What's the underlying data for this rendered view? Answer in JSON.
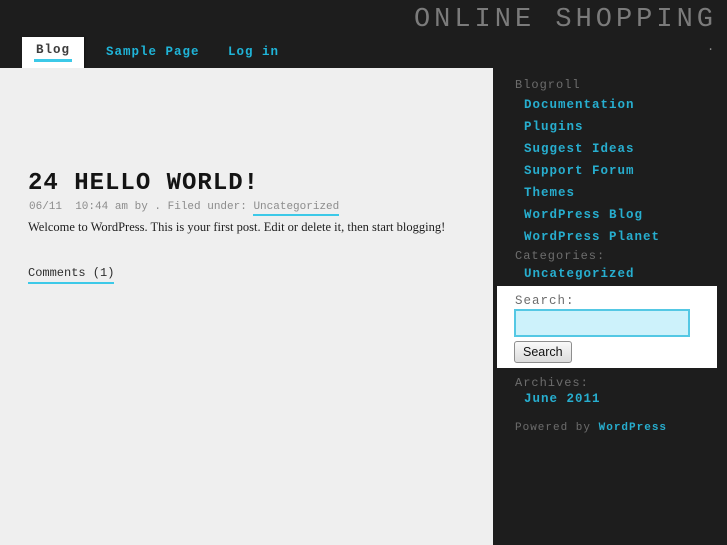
{
  "header": {
    "site_title": "ONLINE SHOPPING",
    "dot": ".",
    "nav": [
      {
        "label": "Blog",
        "active": true
      },
      {
        "label": "Sample Page",
        "active": false
      },
      {
        "label": "Log in",
        "active": false
      }
    ]
  },
  "post": {
    "title": "24 HELLO WORLD!",
    "meta_prefix": "06/11  10:44 am by . Filed under: ",
    "meta_category": "Uncategorized",
    "body": "Welcome to WordPress. This is your first post. Edit or delete it, then start blogging!",
    "comments_label": "Comments (1)"
  },
  "sidebar": {
    "blogroll_heading": "Blogroll",
    "blogroll_links": [
      "Documentation",
      "Plugins",
      "Suggest Ideas",
      "Support Forum",
      "Themes",
      "WordPress Blog",
      "WordPress Planet"
    ],
    "categories_heading": "Categories:",
    "categories_links": [
      "Uncategorized"
    ],
    "search": {
      "label": "Search:",
      "input_value": "",
      "button_label": "Search"
    },
    "archives_heading": "Archives:",
    "archives_links": [
      "June 2011"
    ],
    "powered_by_prefix": "Powered by ",
    "powered_by_link": "WordPress"
  },
  "colors": {
    "accent_cyan": "#1fb4d8",
    "accent_underline": "#3cc9e8",
    "sidebar_link": "#27aecf",
    "dark_bg": "#1d1d1d",
    "content_bg": "#efefef",
    "muted_gray": "#6d6d6d",
    "meta_gray": "#8c8c8c",
    "title_gray": "#7b7b7b",
    "input_bg": "#cdf2fb",
    "input_border": "#54c8e4"
  }
}
